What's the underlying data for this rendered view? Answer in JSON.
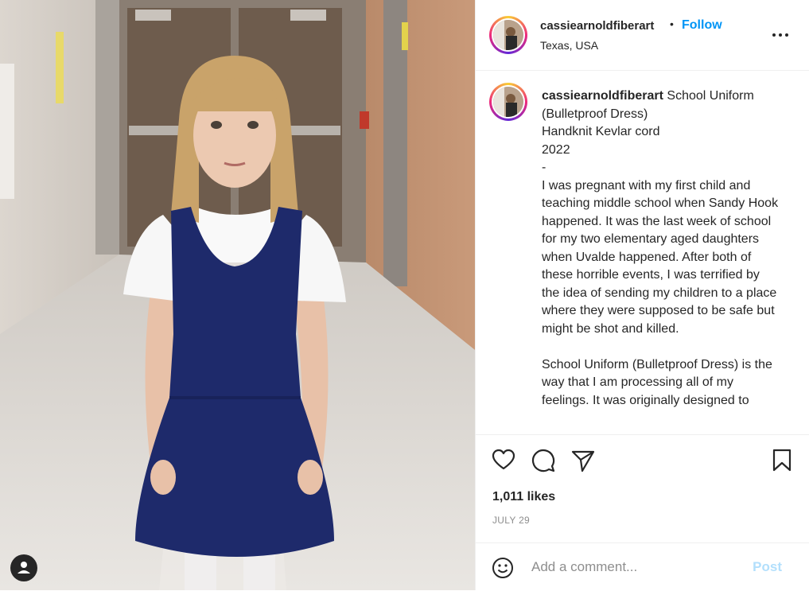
{
  "header": {
    "username": "cassiearnoldfiberart",
    "separator": "•",
    "follow_label": "Follow",
    "location": "Texas, USA",
    "more_icon": "more-horizontal-icon"
  },
  "caption": {
    "username": "cassiearnoldfiberart",
    "text": "School Uniform (Bulletproof Dress)\nHandknit Kevlar cord\n2022\n-\nI was pregnant with my first child and teaching middle school when Sandy Hook happened. It was the last week of school for my two elementary aged daughters when Uvalde happened. After both of these horrible events, I was terrified by the idea of sending my children to a place where they were supposed to be safe but might be shot and killed.\n\nSchool Uniform (Bulletproof Dress) is the way that I am processing all of my feelings. It was originally designed to"
  },
  "actions": {
    "likes": "1,011 likes",
    "date": "JULY 29",
    "icons": [
      "heart-icon",
      "comment-icon",
      "share-icon",
      "bookmark-icon"
    ]
  },
  "comment": {
    "placeholder": "Add a comment...",
    "post_label": "Post",
    "emoji_icon": "emoji-icon"
  },
  "colors": {
    "accent": "#0095f6",
    "post_disabled": "#b2dffc",
    "muted": "#8e8e8e",
    "dress": "#1e2a6b"
  }
}
